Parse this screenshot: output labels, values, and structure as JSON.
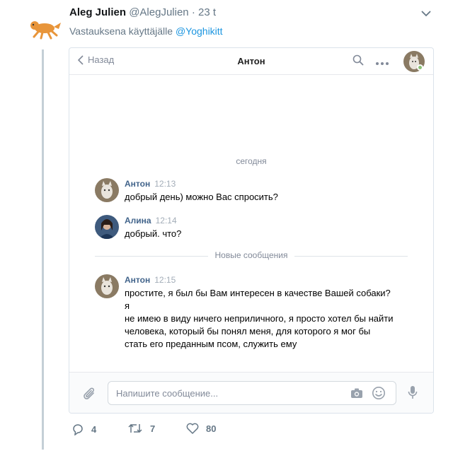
{
  "tweet": {
    "author_name": "Aleg Julien",
    "handle": "@AlegJulien",
    "separator": "·",
    "time": "23 t",
    "reply_prefix": "Vastauksena käyttäjälle",
    "reply_mention": "@Yoghikitt"
  },
  "vk": {
    "back_label": "Назад",
    "title": "Антон",
    "date_separator": "сегодня",
    "new_messages_separator": "Новые сообщения",
    "messages": [
      {
        "author": "Антон",
        "time": "12:13",
        "lines": [
          "добрый день) можно Вас спросить?"
        ]
      },
      {
        "author": "Алина",
        "time": "12:14",
        "lines": [
          "добрый. что?"
        ]
      },
      {
        "author": "Антон",
        "time": "12:15",
        "lines": [
          "простите, я был бы Вам интересен в качестве Вашей собаки? я",
          "не имею в виду ничего неприличного, я просто хотел бы найти",
          "человека, который бы понял меня, для которого я мог бы",
          "стать его преданным псом, служить ему"
        ]
      }
    ],
    "composer_placeholder": "Напишите сообщение..."
  },
  "actions": {
    "replies": "4",
    "retweets": "7",
    "likes": "80"
  },
  "colors": {
    "twitter_link": "#1b95e0",
    "vk_author": "#42648b",
    "muted": "#657786",
    "online": "#8ac176"
  }
}
